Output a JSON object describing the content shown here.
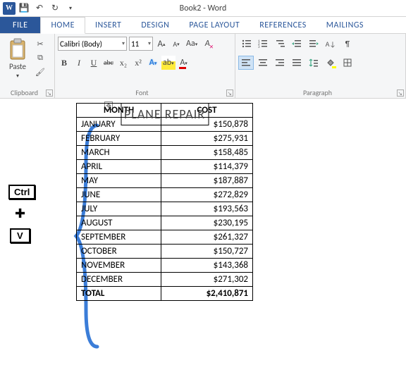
{
  "title": "Book2 - Word",
  "tabs": {
    "file": "FILE",
    "home": "HOME",
    "insert": "INSERT",
    "design": "DESIGN",
    "pagelayout": "PAGE LAYOUT",
    "references": "REFERENCES",
    "mailings": "MAILINGS"
  },
  "clipboard": {
    "paste": "Paste",
    "group": "Clipboard"
  },
  "font": {
    "name": "Calibri (Body)",
    "size": "11",
    "group": "Font",
    "bold": "B",
    "italic": "I",
    "underline": "U",
    "strike": "abc",
    "sub": "x₂",
    "sup": "x²",
    "growA": "A",
    "shrinkA": "A",
    "caseAa": "Aa",
    "clear": "A",
    "texteff": "A",
    "highlight": "ab",
    "color": "A"
  },
  "para": {
    "group": "Paragraph"
  },
  "shortcut": {
    "ctrl": "Ctrl",
    "v": "V"
  },
  "table": {
    "title": "PLANE REPAIR",
    "headers": {
      "month": "MONTH",
      "cost": "COST"
    },
    "rows": [
      {
        "m": "JANUARY",
        "c": "$150,878"
      },
      {
        "m": "FEBRUARY",
        "c": "$275,931"
      },
      {
        "m": "MARCH",
        "c": "$158,485"
      },
      {
        "m": "APRIL",
        "c": "$114,379"
      },
      {
        "m": "MAY",
        "c": "$187,887"
      },
      {
        "m": "JUNE",
        "c": "$272,829"
      },
      {
        "m": "JULY",
        "c": "$193,563"
      },
      {
        "m": "AUGUST",
        "c": "$230,195"
      },
      {
        "m": "SEPTEMBER",
        "c": "$261,327"
      },
      {
        "m": "OCTOBER",
        "c": "$150,727"
      },
      {
        "m": "NOVEMBER",
        "c": "$143,368"
      },
      {
        "m": "DECEMBER",
        "c": "$271,302"
      }
    ],
    "total": {
      "label": "TOTAL",
      "value": "$2,410,871"
    }
  }
}
